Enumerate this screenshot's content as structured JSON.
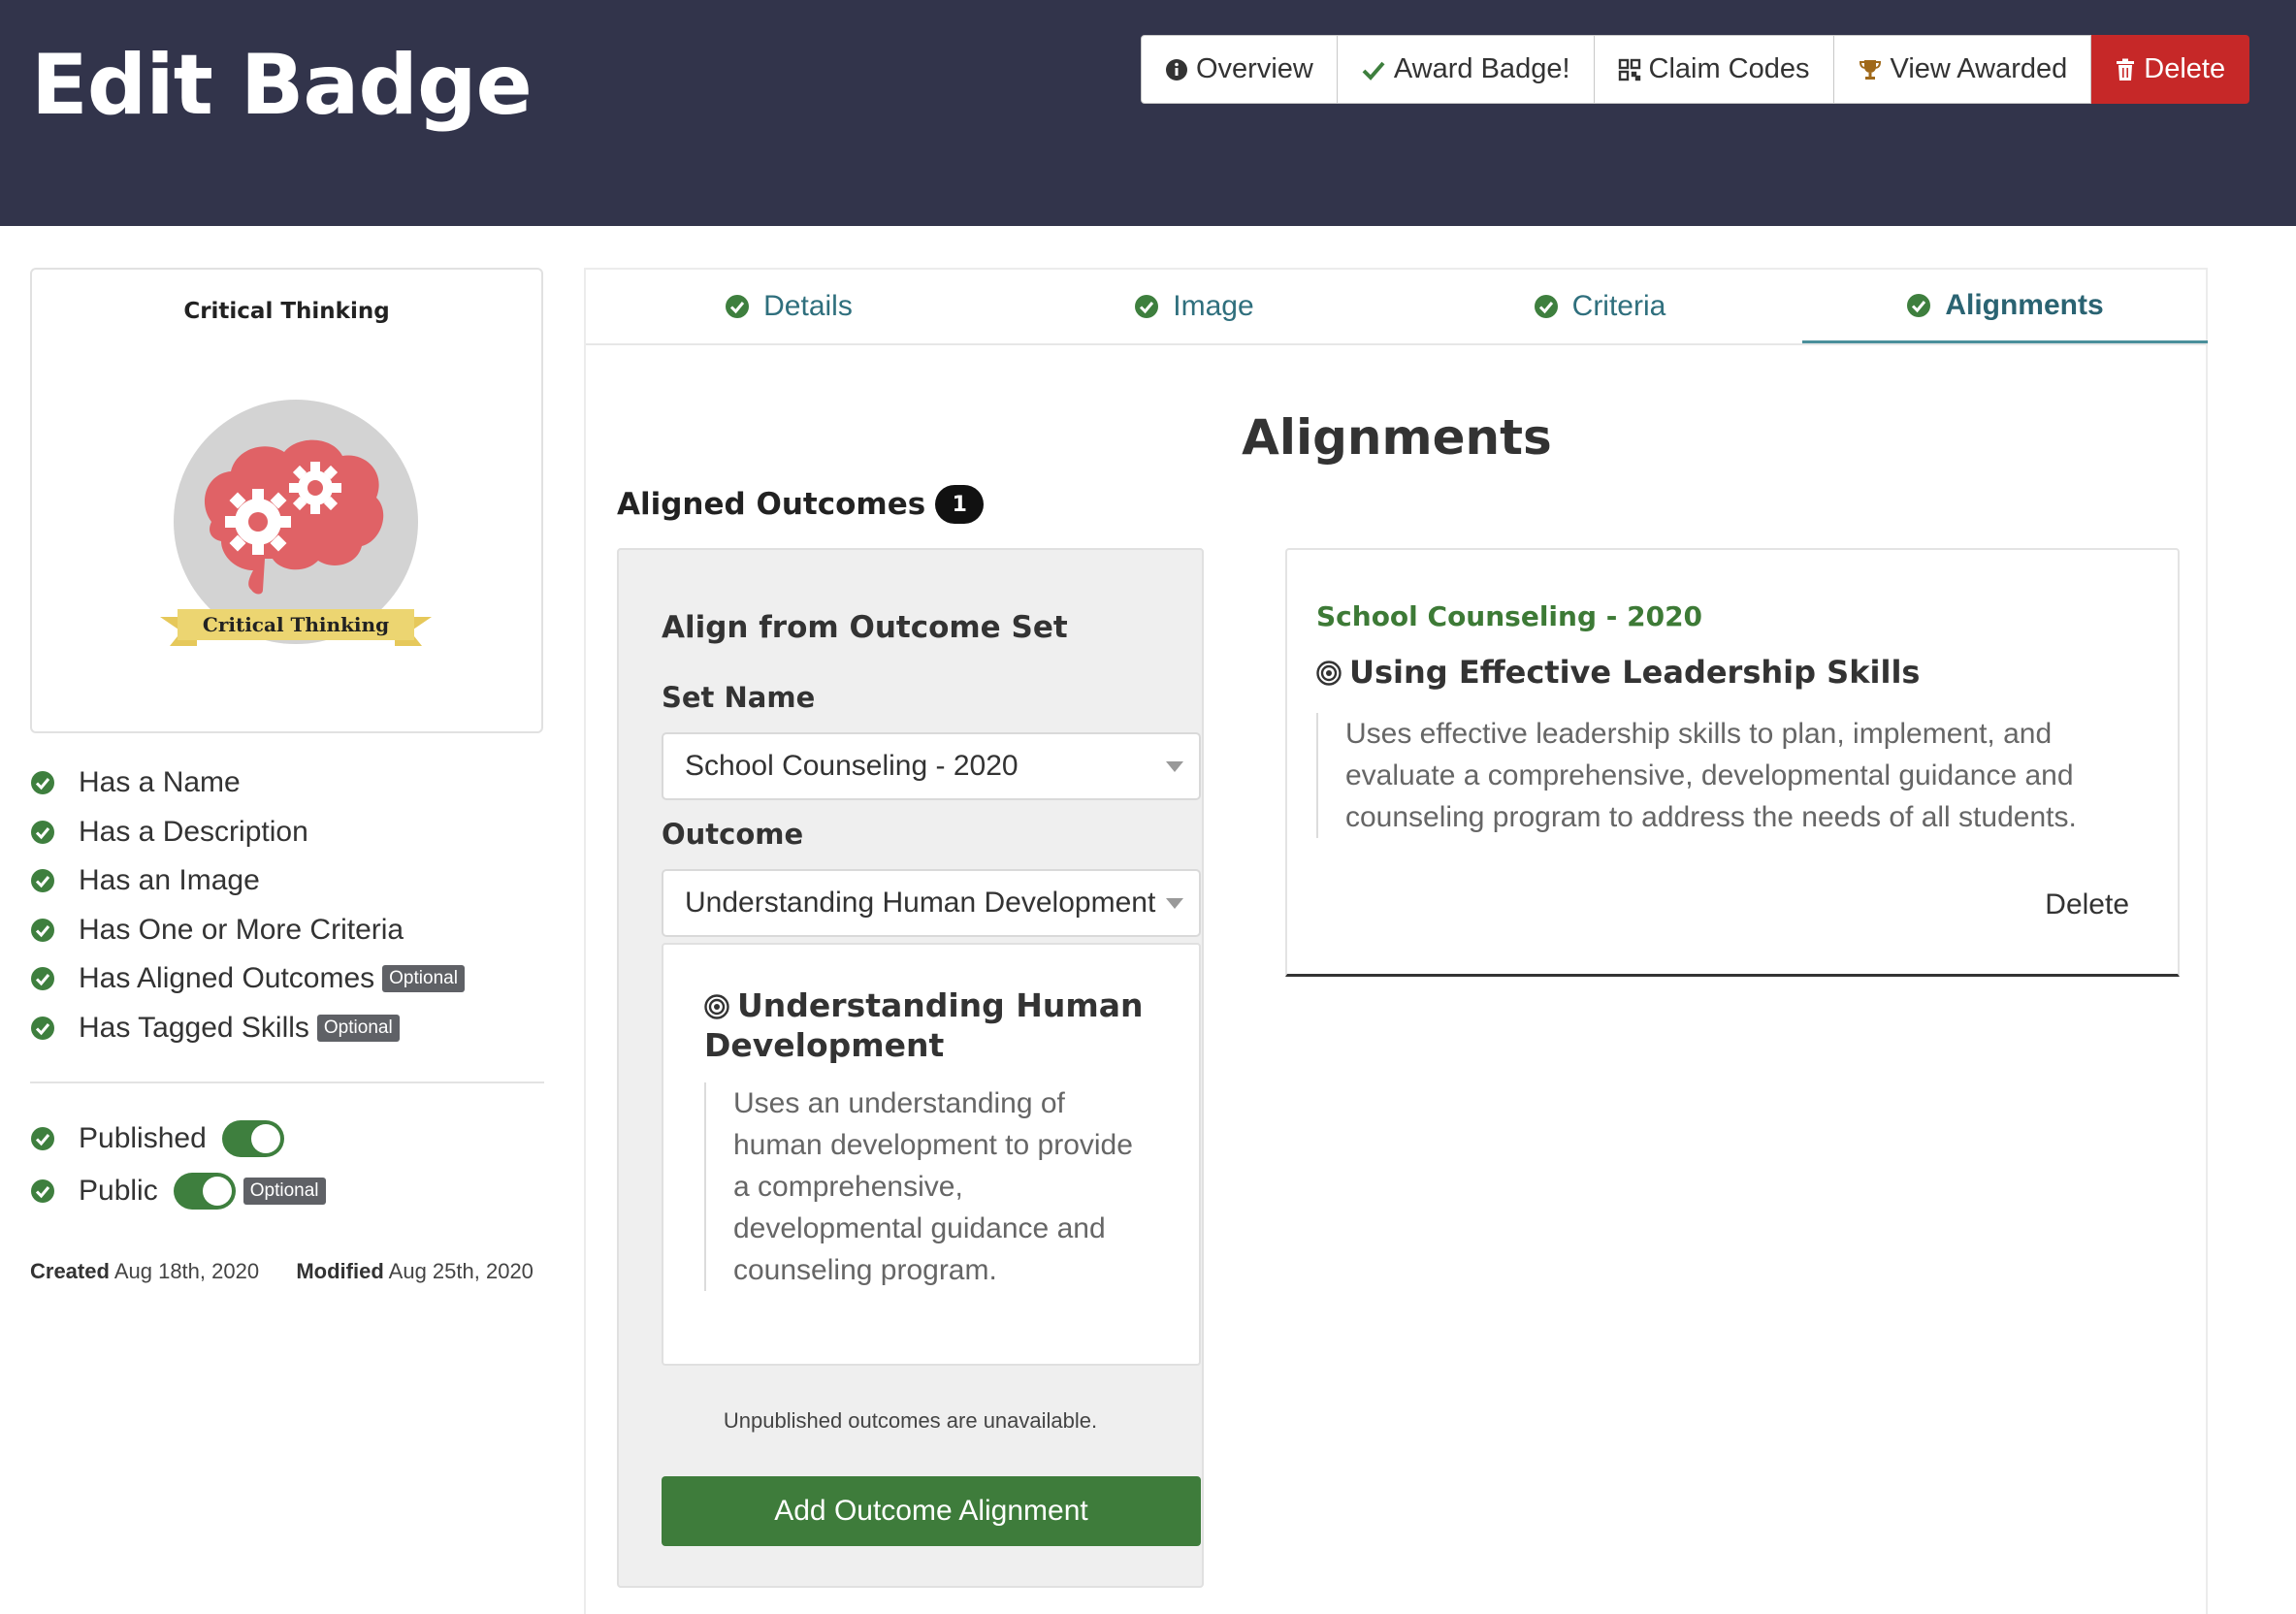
{
  "header": {
    "title": "Edit Badge",
    "buttons": {
      "overview": "Overview",
      "award": "Award Badge!",
      "claim_codes": "Claim Codes",
      "view_awarded": "View Awarded",
      "delete": "Delete"
    }
  },
  "badge": {
    "name": "Critical Thinking",
    "ribbon_text": "Critical Thinking"
  },
  "checklist": [
    {
      "label": "Has a Name",
      "optional": ""
    },
    {
      "label": "Has a Description",
      "optional": ""
    },
    {
      "label": "Has an Image",
      "optional": ""
    },
    {
      "label": "Has One or More Criteria",
      "optional": ""
    },
    {
      "label": "Has Aligned Outcomes",
      "optional": "Optional"
    },
    {
      "label": "Has Tagged Skills",
      "optional": "Optional"
    }
  ],
  "toggles": {
    "published": {
      "label": "Published",
      "on": true
    },
    "public": {
      "label": "Public",
      "on": true,
      "optional": "Optional"
    }
  },
  "meta": {
    "created_label": "Created",
    "created": "Aug 18th, 2020",
    "modified_label": "Modified",
    "modified": "Aug 25th, 2020"
  },
  "tabs": [
    {
      "label": "Details",
      "active": false
    },
    {
      "label": "Image",
      "active": false
    },
    {
      "label": "Criteria",
      "active": false
    },
    {
      "label": "Alignments",
      "active": true
    }
  ],
  "alignments": {
    "title": "Alignments",
    "aligned_outcomes_label": "Aligned Outcomes",
    "aligned_count": "1",
    "form": {
      "title": "Align from Outcome Set",
      "set_name_label": "Set Name",
      "set_name_value": "School Counseling - 2020",
      "outcome_label": "Outcome",
      "outcome_value": "Understanding Human Development",
      "preview_title": "Understanding Human Development",
      "preview_description": "Uses an understanding of human development to provide a comprehensive, developmental guidance and counseling program.",
      "note": "Unpublished outcomes are unavailable.",
      "add_button": "Add Outcome Alignment"
    },
    "outcome": {
      "set": "School Counseling - 2020",
      "name": "Using Effective Leadership Skills",
      "description": "Uses effective leadership skills to plan, implement, and evaluate a comprehensive, developmental guidance and counseling program to address the needs of all students.",
      "delete": "Delete"
    }
  },
  "colors": {
    "header_bg": "#32344b",
    "success": "#3e7f3e",
    "danger": "#c62828",
    "tab_text": "#2f6f7d"
  }
}
